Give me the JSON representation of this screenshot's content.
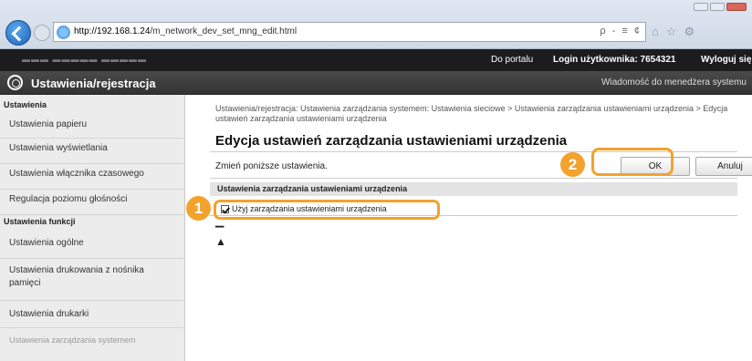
{
  "browser": {
    "url_host": "http://192.168.1.24",
    "url_path": "/m_network_dev_set_mng_edit.html",
    "tools": "ρ - ≡ ¢"
  },
  "topbar": {
    "portal": "Do portalu",
    "login": "Login użytkownika:  7654321",
    "logout": "Wyloguj się"
  },
  "titlebar": {
    "title": "Ustawienia/rejestracja",
    "message": "Wiadomość do menedżera systemu"
  },
  "sidebar": {
    "section1": "Ustawienia",
    "items1": [
      "Ustawienia papieru",
      "Ustawienia wyświetlania",
      "Ustawienia włącznika czasowego",
      "Regulacja poziomu głośności"
    ],
    "section2": "Ustawienia funkcji",
    "items2": [
      "Ustawienia ogólne",
      "Ustawienia drukowania z nośnika pamięci",
      "Ustawienia drukarki"
    ],
    "section3": "Ustawienia zarządzania systemem"
  },
  "main": {
    "breadcrumb": "Ustawienia/rejestracja: Ustawienia zarządzania systemem: Ustawienia sieciowe > Ustawienia zarządzania ustawieniami urządzenia > Edycja ustawień zarządzania ustawieniami urządzenia",
    "heading": "Edycja ustawień zarządzania ustawieniami urządzenia",
    "instruction": "Zmień poniższe ustawienia.",
    "ok_label": "OK",
    "cancel_label": "Anuluj",
    "section_title": "Ustawienia zarządzania ustawieniami urządzenia",
    "checkbox_label": "Użyj zarządzania ustawieniami urządzenia",
    "checkbox_checked": true
  },
  "callouts": {
    "one": "1",
    "two": "2"
  },
  "colors": {
    "callout": "#f2a22d",
    "topbar": "#1c1c1c"
  }
}
